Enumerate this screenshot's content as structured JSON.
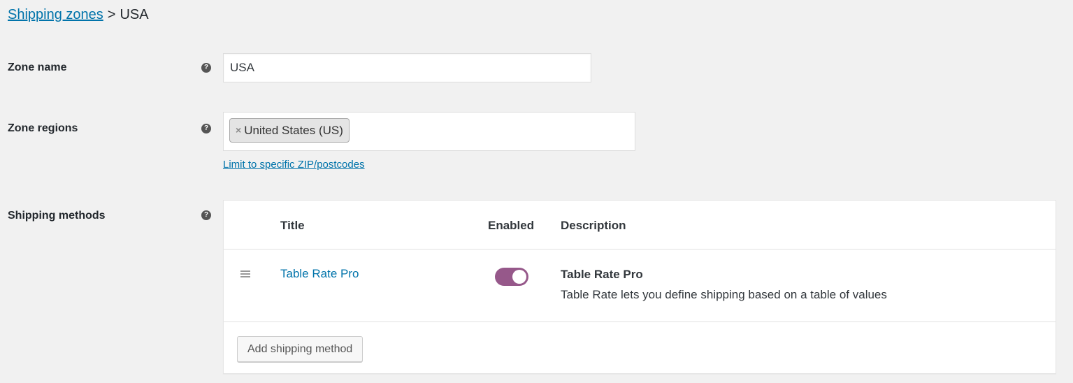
{
  "breadcrumb": {
    "parent_label": "Shipping zones",
    "separator": ">",
    "current": "USA"
  },
  "zone_name": {
    "label": "Zone name",
    "help_icon": "question-circle-icon",
    "value": "USA"
  },
  "zone_regions": {
    "label": "Zone regions",
    "help_icon": "question-circle-icon",
    "chips": [
      {
        "remove_glyph": "×",
        "label": "United States (US)"
      }
    ],
    "limit_link": "Limit to specific ZIP/postcodes"
  },
  "shipping_methods": {
    "label": "Shipping methods",
    "help_icon": "question-circle-icon",
    "columns": [
      "Title",
      "Enabled",
      "Description"
    ],
    "rows": [
      {
        "drag_icon": "drag-handle-icon",
        "title": "Table Rate Pro",
        "enabled": true,
        "description_title": "Table Rate Pro",
        "description": "Table Rate lets you define shipping based on a table of values"
      }
    ],
    "add_button": "Add shipping method"
  },
  "colors": {
    "link": "#0073aa",
    "toggle_on": "#96588a",
    "background": "#f1f1f1"
  }
}
